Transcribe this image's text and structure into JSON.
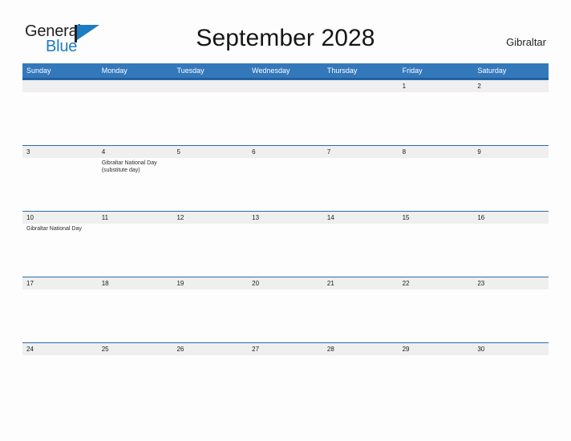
{
  "brand": {
    "name_part1": "General",
    "name_part2": "Blue",
    "flag_icon": "pennant-flag-icon",
    "accent_color": "#1c7cc4"
  },
  "header": {
    "title": "September 2028",
    "locale": "Gibraltar"
  },
  "calendar": {
    "header_bg_color": "#3478bc",
    "date_strip_color": "#efefef",
    "separator_color": "#2a6cb0",
    "day_names": [
      "Sunday",
      "Monday",
      "Tuesday",
      "Wednesday",
      "Thursday",
      "Friday",
      "Saturday"
    ],
    "weeks": [
      [
        {
          "date": "",
          "event": ""
        },
        {
          "date": "",
          "event": ""
        },
        {
          "date": "",
          "event": ""
        },
        {
          "date": "",
          "event": ""
        },
        {
          "date": "",
          "event": ""
        },
        {
          "date": "1",
          "event": ""
        },
        {
          "date": "2",
          "event": ""
        }
      ],
      [
        {
          "date": "3",
          "event": ""
        },
        {
          "date": "4",
          "event": "Gibraltar National Day (substitute day)"
        },
        {
          "date": "5",
          "event": ""
        },
        {
          "date": "6",
          "event": ""
        },
        {
          "date": "7",
          "event": ""
        },
        {
          "date": "8",
          "event": ""
        },
        {
          "date": "9",
          "event": ""
        }
      ],
      [
        {
          "date": "10",
          "event": "Gibraltar National Day"
        },
        {
          "date": "11",
          "event": ""
        },
        {
          "date": "12",
          "event": ""
        },
        {
          "date": "13",
          "event": ""
        },
        {
          "date": "14",
          "event": ""
        },
        {
          "date": "15",
          "event": ""
        },
        {
          "date": "16",
          "event": ""
        }
      ],
      [
        {
          "date": "17",
          "event": ""
        },
        {
          "date": "18",
          "event": ""
        },
        {
          "date": "19",
          "event": ""
        },
        {
          "date": "20",
          "event": ""
        },
        {
          "date": "21",
          "event": ""
        },
        {
          "date": "22",
          "event": ""
        },
        {
          "date": "23",
          "event": ""
        }
      ],
      [
        {
          "date": "24",
          "event": ""
        },
        {
          "date": "25",
          "event": ""
        },
        {
          "date": "26",
          "event": ""
        },
        {
          "date": "27",
          "event": ""
        },
        {
          "date": "28",
          "event": ""
        },
        {
          "date": "29",
          "event": ""
        },
        {
          "date": "30",
          "event": ""
        }
      ]
    ]
  }
}
